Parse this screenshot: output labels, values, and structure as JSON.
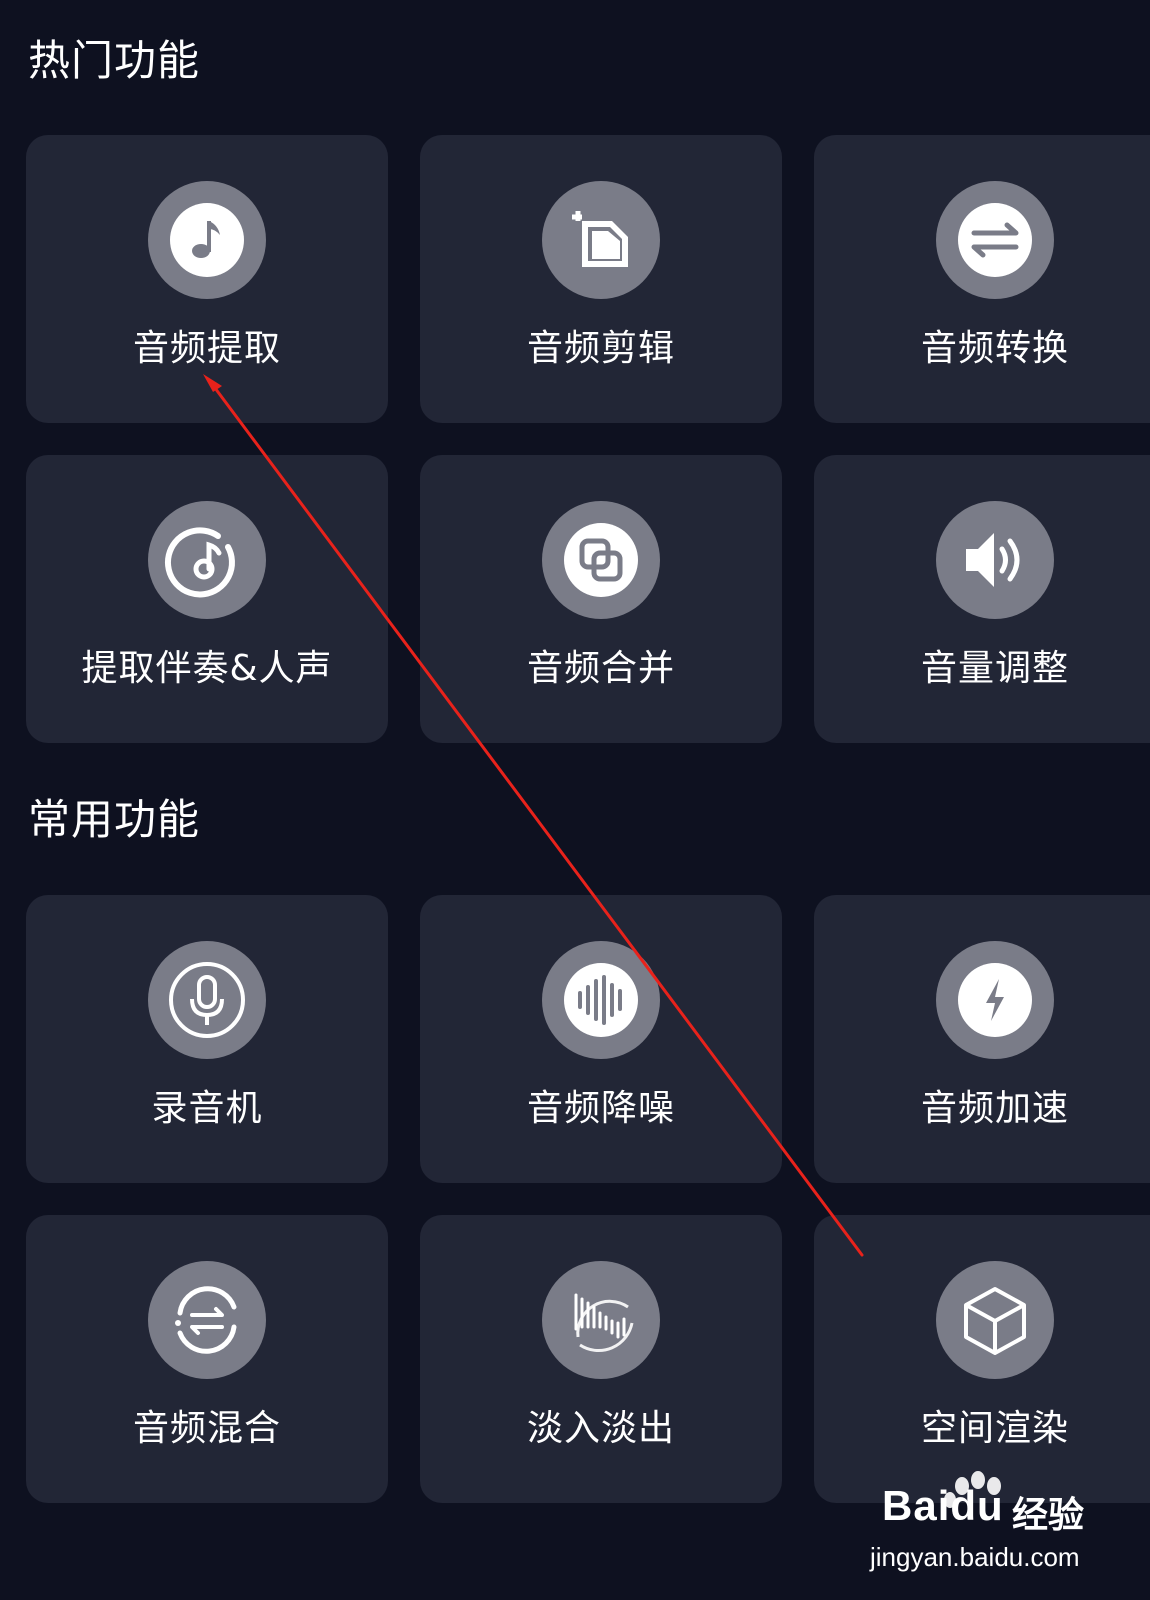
{
  "sections": {
    "hot": {
      "title": "热门功能",
      "items": [
        {
          "label": "音频提取",
          "icon": "music-note-icon"
        },
        {
          "label": "音频剪辑",
          "icon": "crop-icon"
        },
        {
          "label": "音频转换",
          "icon": "swap-arrows-icon"
        },
        {
          "label": "提取伴奏&人声",
          "icon": "vocal-extract-icon"
        },
        {
          "label": "音频合并",
          "icon": "merge-icon"
        },
        {
          "label": "音量调整",
          "icon": "volume-icon"
        }
      ]
    },
    "common": {
      "title": "常用功能",
      "items": [
        {
          "label": "录音机",
          "icon": "microphone-icon"
        },
        {
          "label": "音频降噪",
          "icon": "waveform-icon"
        },
        {
          "label": "音频加速",
          "icon": "lightning-icon"
        },
        {
          "label": "音频混合",
          "icon": "mix-cycle-icon"
        },
        {
          "label": "淡入淡出",
          "icon": "fade-icon"
        },
        {
          "label": "空间渲染",
          "icon": "cube-icon"
        }
      ]
    }
  },
  "watermark": {
    "brand": "Baidu",
    "cn": "经验",
    "domain": "jingyan.baidu.com"
  },
  "colors": {
    "background": "#0e1120",
    "card": "#222636",
    "icon_circle": "#7a7c88",
    "annotation_arrow": "#e8221b"
  }
}
